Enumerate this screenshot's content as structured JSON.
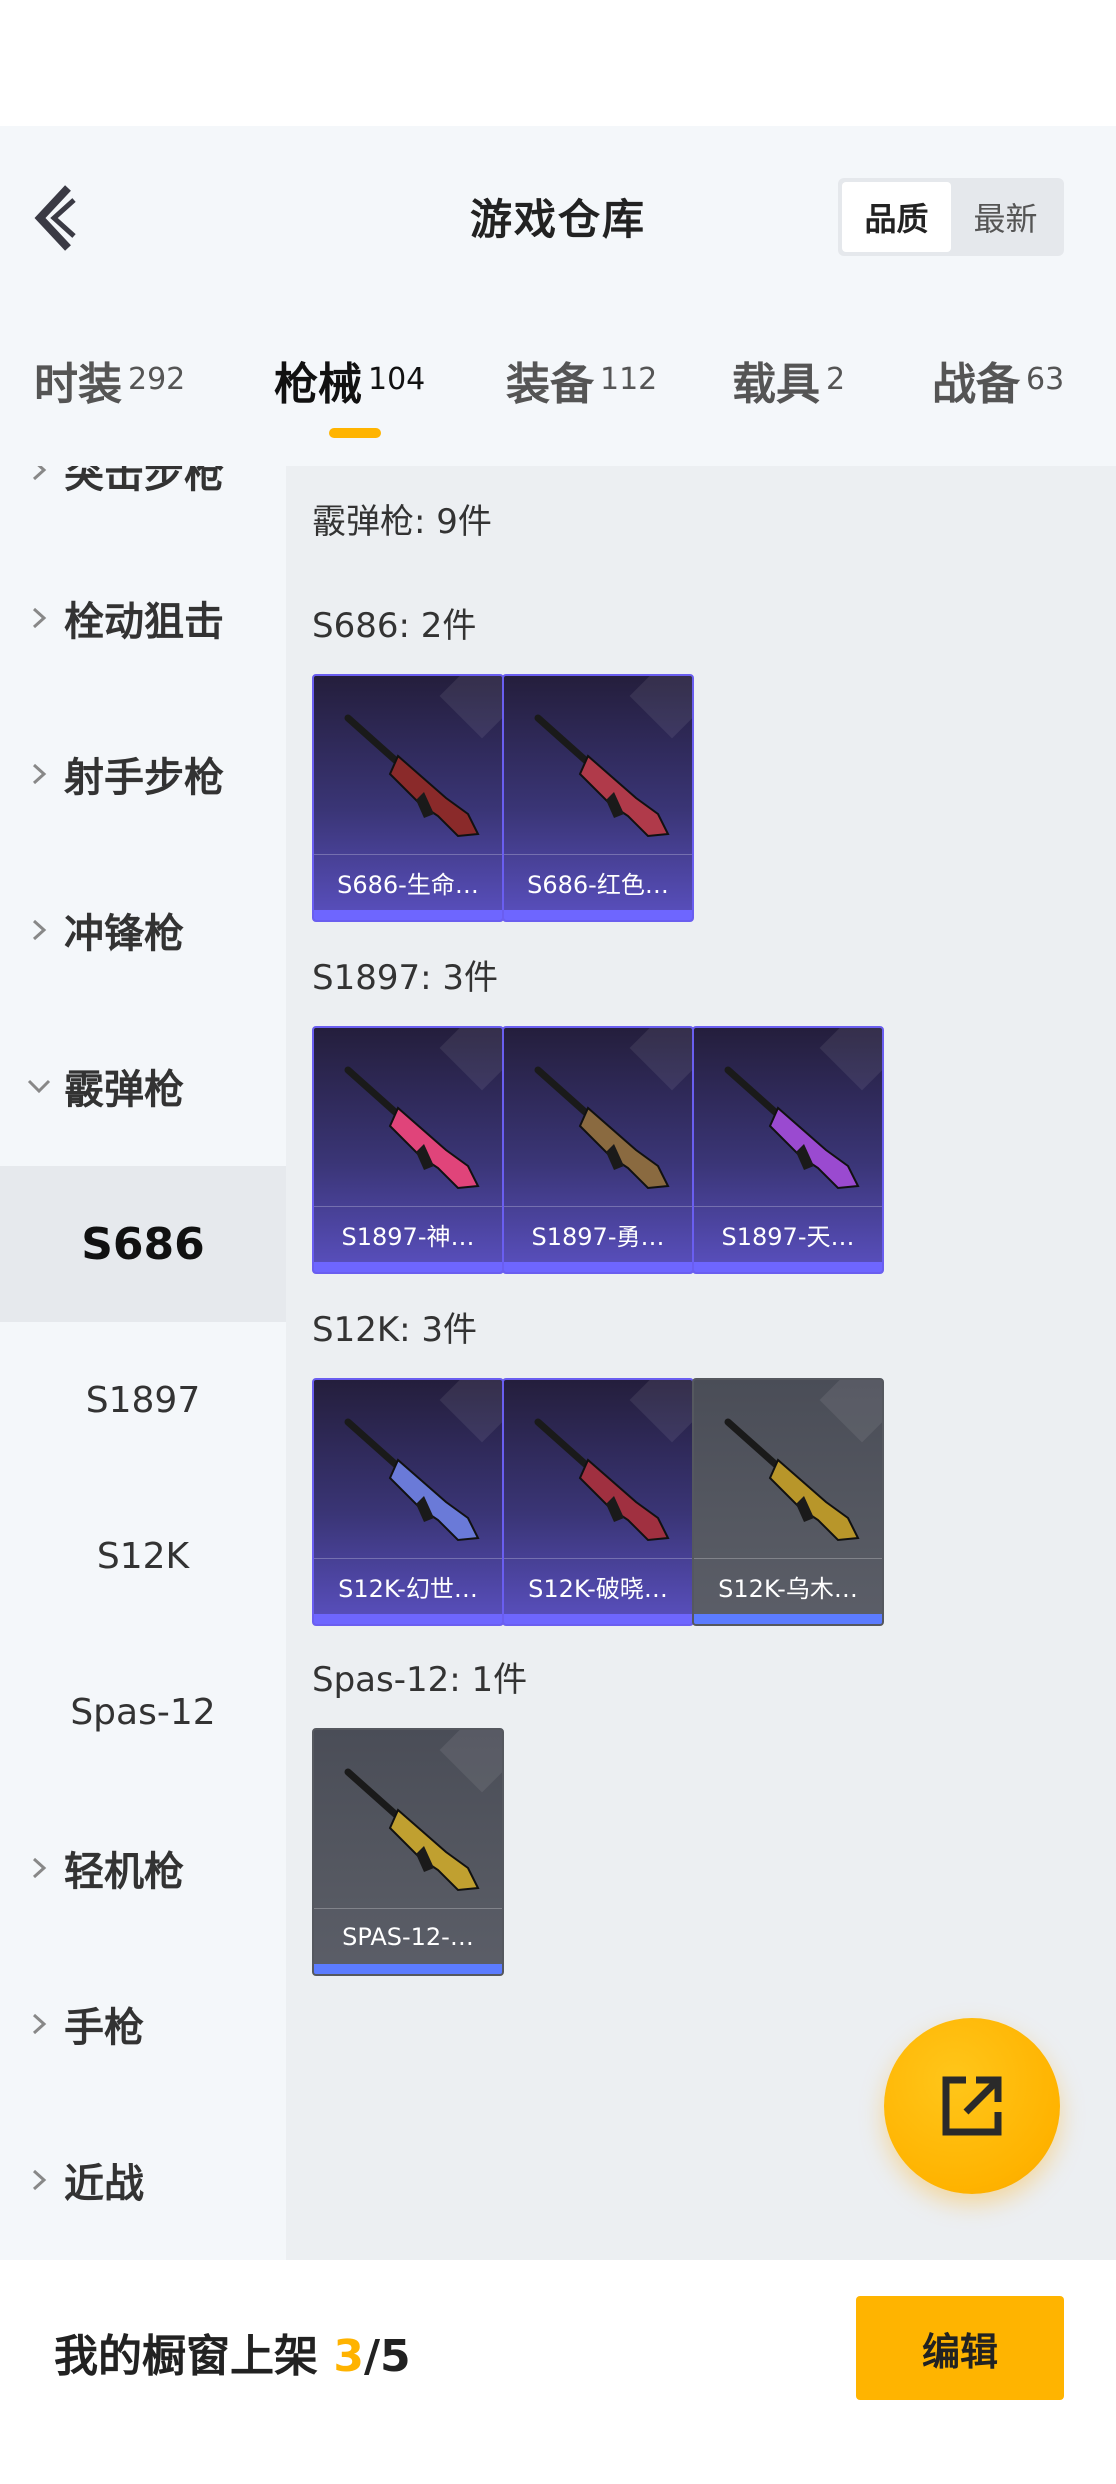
{
  "header": {
    "title": "游戏仓库",
    "sort": [
      {
        "label": "品质",
        "active": true
      },
      {
        "label": "最新",
        "active": false
      }
    ]
  },
  "tabs": [
    {
      "label": "时装",
      "count": "292",
      "active": false
    },
    {
      "label": "枪械",
      "count": "104",
      "active": true
    },
    {
      "label": "装备",
      "count": "112",
      "active": false
    },
    {
      "label": "载具",
      "count": "2",
      "active": false
    },
    {
      "label": "战备",
      "count": "63",
      "active": false
    }
  ],
  "sidebar": {
    "categories": [
      {
        "label": "突击步枪"
      },
      {
        "label": "栓动狙击"
      },
      {
        "label": "射手步枪"
      },
      {
        "label": "冲锋枪"
      },
      {
        "label": "霰弹枪",
        "expanded": true
      },
      {
        "label": "轻机枪"
      },
      {
        "label": "手枪"
      },
      {
        "label": "近战"
      }
    ],
    "subs": [
      {
        "label": "S686",
        "active": true
      },
      {
        "label": "S1897",
        "active": false
      },
      {
        "label": "S12K",
        "active": false
      },
      {
        "label": "Spas-12",
        "active": false
      }
    ]
  },
  "content": {
    "group_title": "霰弹枪: 9件",
    "sections": [
      {
        "title": "S686: 2件",
        "items": [
          {
            "name": "S686-生命…",
            "style": "purple",
            "gun_color": "#8a2a2a"
          },
          {
            "name": "S686-红色…",
            "style": "purple",
            "gun_color": "#b03a4a"
          }
        ]
      },
      {
        "title": "S1897: 3件",
        "items": [
          {
            "name": "S1897-神…",
            "style": "purple",
            "gun_color": "#e0447a"
          },
          {
            "name": "S1897-勇…",
            "style": "purple",
            "gun_color": "#8a6a40"
          },
          {
            "name": "S1897-天…",
            "style": "purple",
            "gun_color": "#9a4ad0"
          }
        ]
      },
      {
        "title": "S12K: 3件",
        "items": [
          {
            "name": "S12K-幻世…",
            "style": "purple",
            "gun_color": "#6a7ad8"
          },
          {
            "name": "S12K-破晓…",
            "style": "purple",
            "gun_color": "#a03040"
          },
          {
            "name": "S12K-乌木…",
            "style": "gray",
            "gun_color": "#b8962a"
          }
        ]
      },
      {
        "title": "Spas-12: 1件",
        "items": [
          {
            "name": "SPAS-12-…",
            "style": "gray",
            "gun_color": "#c0a030"
          }
        ]
      }
    ]
  },
  "showcase": {
    "prefix": "我的橱窗上架 ",
    "current": "3",
    "total": "/5",
    "edit_label": "编辑"
  },
  "icons": {
    "back": "back-chevron-icon",
    "share": "share-external-icon",
    "expand": "chevron-right-icon",
    "collapse": "chevron-down-icon"
  }
}
